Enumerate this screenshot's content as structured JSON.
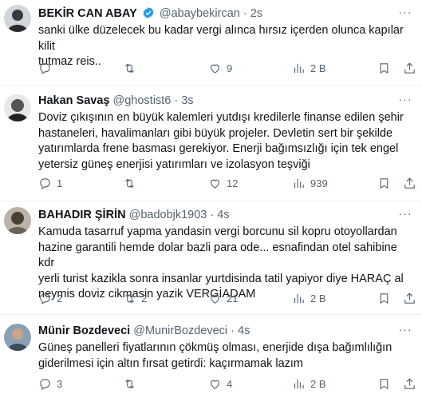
{
  "tweets": [
    {
      "name": "BEKİR CAN ABAY",
      "handle": "@abaybekircan",
      "time": "2s",
      "verified": true,
      "text_lines": [
        "sanki ülke düzelecek bu kadar vergi alınca hırsız içerden olunca kapılar kilit",
        "tutmaz reis.."
      ],
      "replies": "",
      "retweets": "",
      "likes": "9",
      "views": "2 B"
    },
    {
      "name": "Hakan Savaş",
      "handle": "@ghostist6",
      "time": "3s",
      "verified": false,
      "text_lines": [
        "Doviz çıkışının en büyük kalemleri yutdışı kredilerle finanse edilen şehir",
        "hastaneleri, havalimanları gibi büyük projeler. Devletin sert bir şekilde",
        "yatırımlarda frene basması gerekiyor. Enerji bağımsızlığı için tek engel",
        "yetersiz güneş enerjisi yatırımları ve izolasyon teşviği"
      ],
      "replies": "1",
      "retweets": "",
      "likes": "12",
      "views": "939"
    },
    {
      "name": "BAHADIR ŞİRİN",
      "handle": "@badobjk1903",
      "time": "4s",
      "verified": false,
      "text_lines": [
        "Kamuda tasarruf yapma yandasin vergi borcunu sil kopru otoyollardan",
        "hazine garantili hemde dolar bazli  para ode... esnafindan otel sahibine kdr",
        "yerli turist kazikla  sonra insanlar yurtdisinda tatil yapiyor diye HARAÇ al",
        "neymis doviz cikmasin yazik VERGİADAM"
      ],
      "replies": "2",
      "retweets": "2",
      "likes": "21",
      "views": "2 B"
    },
    {
      "name": "Münir Bozdeveci",
      "handle": "@MunirBozdeveci",
      "time": "4s",
      "verified": false,
      "text_lines": [
        "Güneş panelleri fiyatlarının çökmüş olması, enerjide dışa bağımlılığın",
        "giderilmesi için altın fırsat getirdi: kaçırmamak lazım"
      ],
      "replies": "3",
      "retweets": "",
      "likes": "4",
      "views": "2 B"
    }
  ],
  "separator": "·",
  "more_label": "···",
  "colors": {
    "text": "#0f1419",
    "muted": "#536471",
    "verified": "#1d9bf0",
    "border": "#eff3f4"
  },
  "icons": [
    "reply-icon",
    "retweet-icon",
    "like-icon",
    "views-icon",
    "bookmark-icon",
    "share-icon",
    "verified-badge-icon",
    "more-icon"
  ]
}
